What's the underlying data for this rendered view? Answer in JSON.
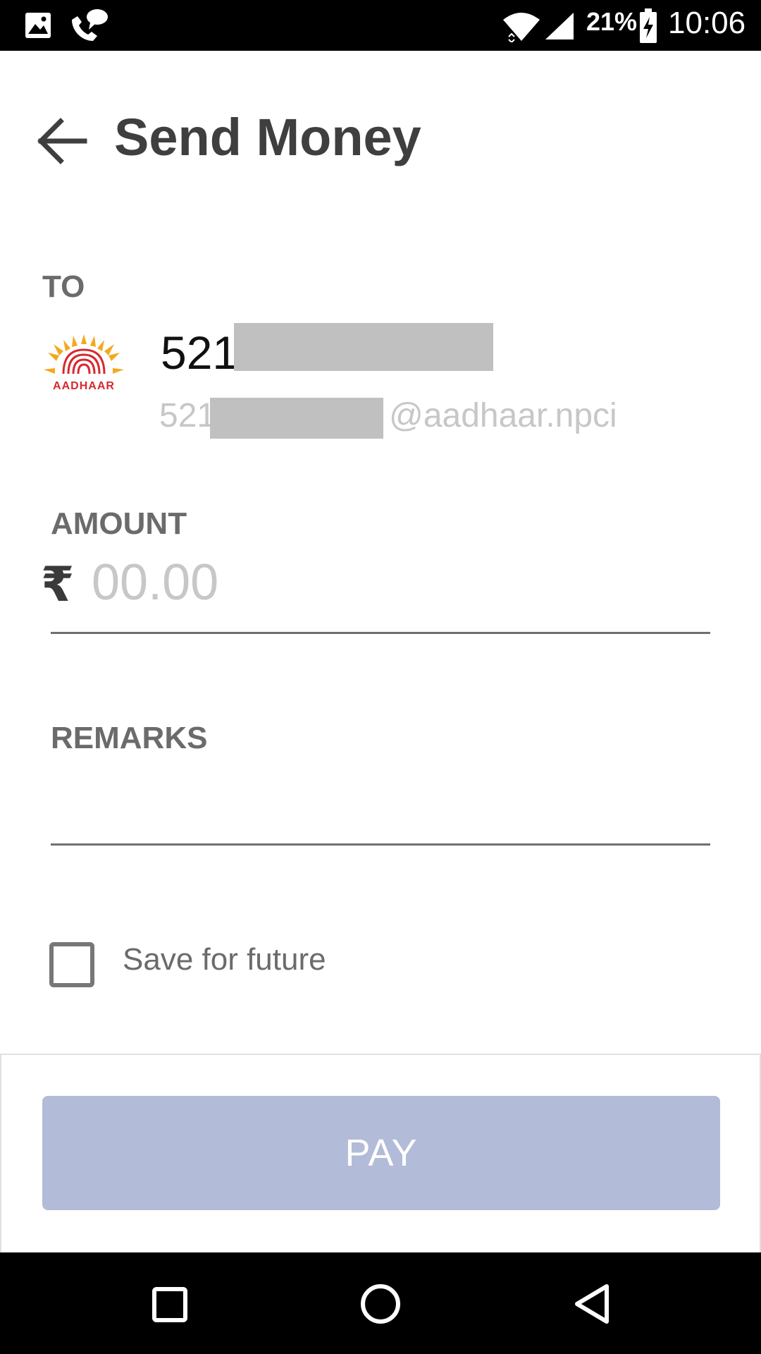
{
  "status_bar": {
    "battery_percent": "21%",
    "time": "10:06",
    "icons": [
      "image-icon",
      "call-chat-icon",
      "wifi-icon",
      "signal-icon",
      "battery-charging-icon"
    ]
  },
  "header": {
    "back_icon": "arrow-left-icon",
    "title": "Send Money"
  },
  "recipient": {
    "section_label": "TO",
    "logo_text": "AADHAAR",
    "name_prefix": "521",
    "vpa_prefix": "521",
    "vpa_suffix": "@aadhaar.npci"
  },
  "amount": {
    "section_label": "AMOUNT",
    "currency_symbol": "₹",
    "placeholder": "00.00",
    "value": ""
  },
  "remarks": {
    "section_label": "REMARKS",
    "value": ""
  },
  "save_option": {
    "label": "Save for future",
    "checked": false
  },
  "pay": {
    "label": "PAY",
    "color": "#b2bbd7"
  },
  "navigation": {
    "items": [
      "recents-square-icon",
      "home-circle-icon",
      "back-triangle-icon"
    ]
  }
}
